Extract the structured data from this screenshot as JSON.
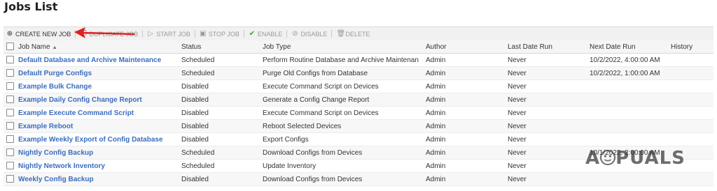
{
  "page": {
    "title": "Jobs List"
  },
  "toolbar": {
    "create": "CREATE NEW JOB",
    "duplicate": "DUPLICATE JOB",
    "start": "START JOB",
    "stop": "STOP JOB",
    "enable": "ENABLE",
    "disable": "DISABLE",
    "delete": "DELETE"
  },
  "table": {
    "headers": {
      "job_name": "Job Name",
      "status": "Status",
      "job_type": "Job Type",
      "author": "Author",
      "last_date_run": "Last Date Run",
      "next_date_run": "Next Date Run",
      "history": "History"
    },
    "rows": [
      {
        "name": "Default Database and Archive Maintenance",
        "status": "Scheduled",
        "type": "Perform Routine Database and Archive Maintenan",
        "author": "Admin",
        "last": "Never",
        "next": "10/2/2022, 4:00:00 AM",
        "history": ""
      },
      {
        "name": "Default Purge Configs",
        "status": "Scheduled",
        "type": "Purge Old Configs from Database",
        "author": "Admin",
        "last": "Never",
        "next": "10/2/2022, 1:00:00 AM",
        "history": ""
      },
      {
        "name": "Example Bulk Change",
        "status": "Disabled",
        "type": "Execute Command Script on Devices",
        "author": "Admin",
        "last": "Never",
        "next": "",
        "history": ""
      },
      {
        "name": "Example Daily Config Change Report",
        "status": "Disabled",
        "type": "Generate a Config Change Report",
        "author": "Admin",
        "last": "Never",
        "next": "",
        "history": ""
      },
      {
        "name": "Example Execute Command Script",
        "status": "Disabled",
        "type": "Execute Command Script on Devices",
        "author": "Admin",
        "last": "Never",
        "next": "",
        "history": ""
      },
      {
        "name": "Example Reboot",
        "status": "Disabled",
        "type": "Reboot Selected Devices",
        "author": "Admin",
        "last": "Never",
        "next": "",
        "history": ""
      },
      {
        "name": "Example Weekly Export of Config Database",
        "status": "Disabled",
        "type": "Export Configs",
        "author": "Admin",
        "last": "Never",
        "next": "",
        "history": ""
      },
      {
        "name": "Nightly Config Backup",
        "status": "Scheduled",
        "type": "Download Configs from Devices",
        "author": "Admin",
        "last": "Never",
        "next": "10/1/2022, 2:00:00 AM",
        "history": ""
      },
      {
        "name": "Nightly Network Inventory",
        "status": "Scheduled",
        "type": "Update Inventory",
        "author": "Admin",
        "last": "Never",
        "next": "",
        "history": ""
      },
      {
        "name": "Weekly Config Backup",
        "status": "Disabled",
        "type": "Download Configs from Devices",
        "author": "Admin",
        "last": "Never",
        "next": "",
        "history": ""
      }
    ]
  },
  "watermark": {
    "text_left": "A",
    "text_right": "PUALS"
  },
  "colors": {
    "link": "#3a6dbf",
    "annotation_arrow": "#e02020",
    "enable_icon": "#3aa03a"
  }
}
